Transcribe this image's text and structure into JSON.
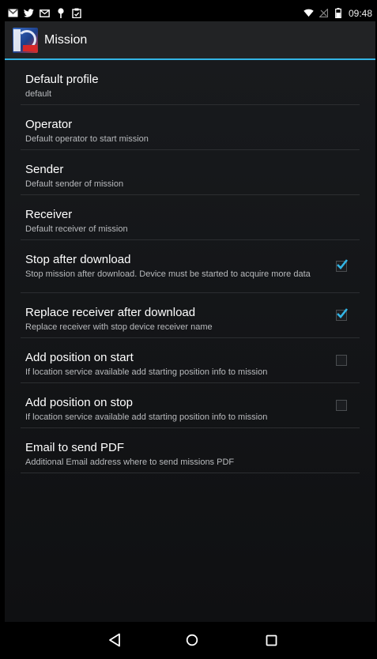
{
  "status_bar": {
    "icons": [
      "gmail-icon",
      "twitter-icon",
      "mail-icon",
      "location-pin-icon",
      "clipboard-icon"
    ],
    "right_icons": [
      "wifi-icon",
      "no-signal-icon",
      "battery-icon"
    ],
    "time": "09:48"
  },
  "action_bar": {
    "title": "Mission",
    "logo": "app-logo-icon"
  },
  "preferences": [
    {
      "title": "Default profile",
      "summary": "default",
      "has_checkbox": false
    },
    {
      "title": "Operator",
      "summary": "Default operator to start mission",
      "has_checkbox": false
    },
    {
      "title": "Sender",
      "summary": "Default sender of mission",
      "has_checkbox": false
    },
    {
      "title": "Receiver",
      "summary": "Default receiver of mission",
      "has_checkbox": false
    },
    {
      "title": "Stop after download",
      "summary": "Stop mission after download. Device must be started to acquire more data",
      "has_checkbox": true,
      "checked": true
    },
    {
      "title": "Replace receiver after download",
      "summary": "Replace receiver with stop device receiver name",
      "has_checkbox": true,
      "checked": true
    },
    {
      "title": "Add position on start",
      "summary": "If location service available add starting position info to mission",
      "has_checkbox": true,
      "checked": false
    },
    {
      "title": "Add position on stop",
      "summary": "If location service available add starting position info to mission",
      "has_checkbox": true,
      "checked": false
    },
    {
      "title": "Email to send PDF",
      "summary": "Additional Email address where to send missions PDF",
      "has_checkbox": false
    }
  ],
  "nav_bar": {
    "buttons": [
      "back-icon",
      "home-icon",
      "recents-icon"
    ]
  },
  "colors": {
    "accent": "#33b5e5",
    "actionbar_bg": "#222325",
    "content_bg": "#181a1d",
    "divider": "#2c2e31",
    "summary_text": "#b8babd"
  }
}
